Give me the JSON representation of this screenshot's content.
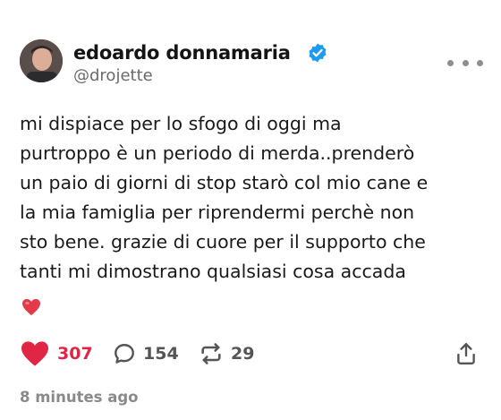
{
  "author": {
    "display_name": "edoardo donnamaria",
    "handle": "@drojette",
    "verified": true
  },
  "post": {
    "text": "mi dispiace per lo sfogo di oggi ma\npurtroppo è un periodo di merda..prenderò\nun paio di giorni di stop starò col mio cane e\nla mia famiglia per riprendermi perchè non\nsto bene. grazie di cuore per il supporto che\ntanti mi dimostrano qualsiasi cosa accada",
    "emoji": "heart-emoji",
    "timestamp": "8 minutes ago"
  },
  "actions": {
    "likes": "307",
    "replies": "154",
    "reposts": "29"
  },
  "colors": {
    "like_red": "#e02545",
    "verified_blue": "#1d9bf0",
    "muted_gray": "#8a8a8a"
  }
}
